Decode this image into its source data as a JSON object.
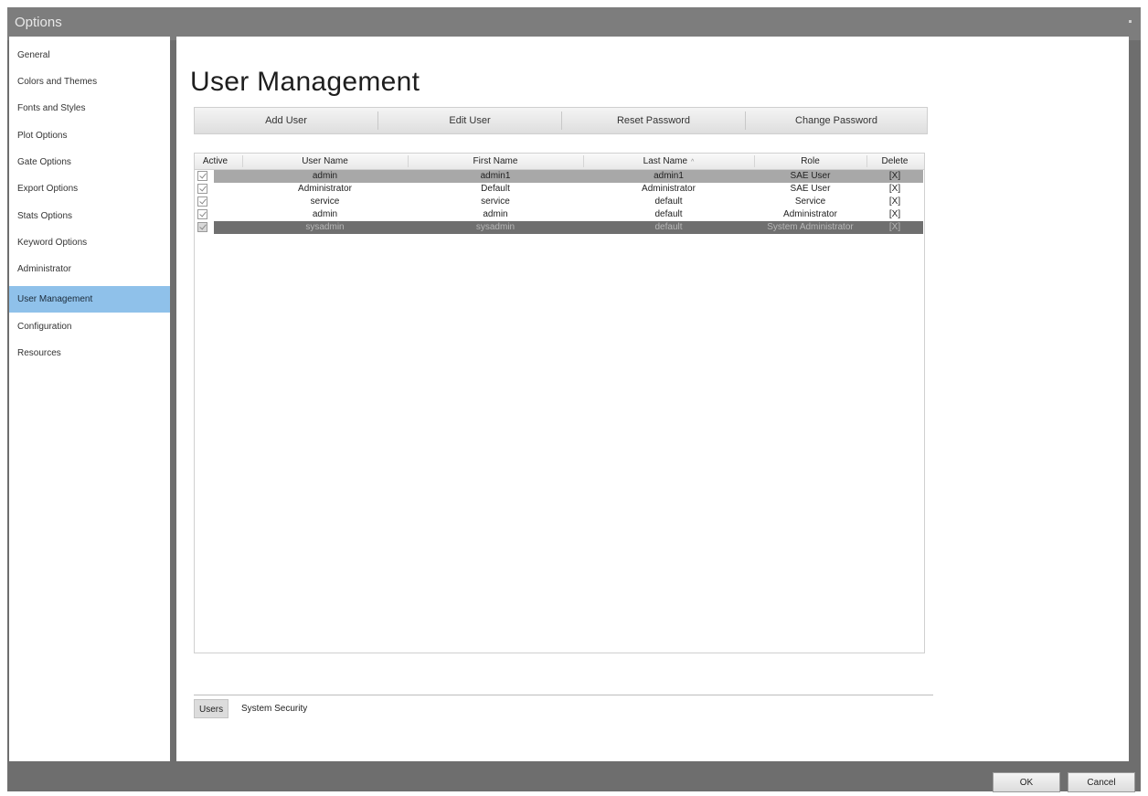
{
  "window": {
    "title": "Options"
  },
  "sidebar": {
    "items": [
      {
        "label": "General"
      },
      {
        "label": "Colors and Themes"
      },
      {
        "label": "Fonts and Styles"
      },
      {
        "label": "Plot Options"
      },
      {
        "label": "Gate Options"
      },
      {
        "label": "Export Options"
      },
      {
        "label": "Stats Options"
      },
      {
        "label": "Keyword Options"
      },
      {
        "label": "Administrator"
      },
      {
        "label": "User Management",
        "selected": true
      },
      {
        "label": "Configuration"
      },
      {
        "label": "Resources"
      }
    ]
  },
  "main": {
    "title": "User Management",
    "toolbar": {
      "add_user": "Add User",
      "edit_user": "Edit User",
      "reset_password": "Reset Password",
      "change_password": "Change Password"
    },
    "grid": {
      "columns": [
        "Active",
        "User Name",
        "First Name",
        "Last Name",
        "Role",
        "Delete"
      ],
      "sort_indicator": "^",
      "rows": [
        {
          "active": true,
          "user_name": "admin",
          "first_name": "admin1",
          "last_name": "admin1",
          "role": "SAE User",
          "delete": "[X]",
          "state": "selected"
        },
        {
          "active": true,
          "user_name": "Administrator",
          "first_name": "Default",
          "last_name": "Administrator",
          "role": "SAE User",
          "delete": "[X]",
          "state": "normal"
        },
        {
          "active": true,
          "user_name": "service",
          "first_name": "service",
          "last_name": "default",
          "role": "Service",
          "delete": "[X]",
          "state": "normal"
        },
        {
          "active": true,
          "user_name": "admin",
          "first_name": "admin",
          "last_name": "default",
          "role": "Administrator",
          "delete": "[X]",
          "state": "normal"
        },
        {
          "active": true,
          "user_name": "sysadmin",
          "first_name": "sysadmin",
          "last_name": "default",
          "role": "System Administrator",
          "delete": "[X]",
          "state": "disabled"
        }
      ]
    },
    "tabs": [
      {
        "label": "Users",
        "active": true
      },
      {
        "label": "System Security",
        "active": false
      }
    ]
  },
  "footer": {
    "ok": "OK",
    "cancel": "Cancel"
  },
  "colors": {
    "selected_nav": "#8fc1ea",
    "selected_row": "#a8a8a8",
    "disabled_row": "#6f6f6f",
    "frame": "#6e6e6e"
  }
}
